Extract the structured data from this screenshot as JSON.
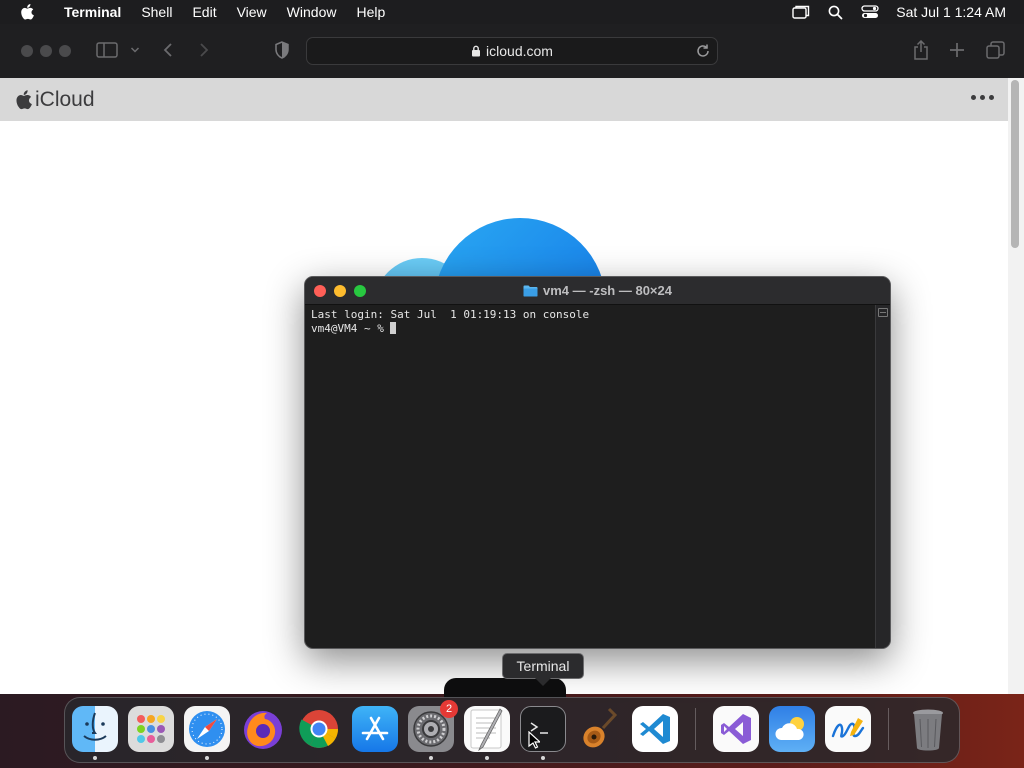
{
  "menubar": {
    "app_name": "Terminal",
    "items": [
      "Shell",
      "Edit",
      "View",
      "Window",
      "Help"
    ],
    "clock": "Sat Jul 1  1:24 AM"
  },
  "safari": {
    "url": "icloud.com",
    "site_title": "iCloud"
  },
  "terminal": {
    "title": "vm4 — -zsh — 80×24",
    "line1": "Last login: Sat Jul  1 01:19:13 on console",
    "prompt": "vm4@VM4 ~ % "
  },
  "tooltip": "Terminal",
  "dock": {
    "settings_badge": "2",
    "apps": [
      "Finder",
      "Launchpad",
      "Safari",
      "Firefox",
      "Google Chrome",
      "App Store",
      "System Settings",
      "TextEdit",
      "Terminal",
      "Instruments",
      "Visual Studio Code",
      "Visual Studio",
      "Weather",
      "Freeform",
      "Trash"
    ]
  },
  "colors": {
    "accent_blue": "#1a8cff",
    "close": "#ff5f57",
    "minimize": "#febc2e",
    "zoom": "#28c840"
  }
}
